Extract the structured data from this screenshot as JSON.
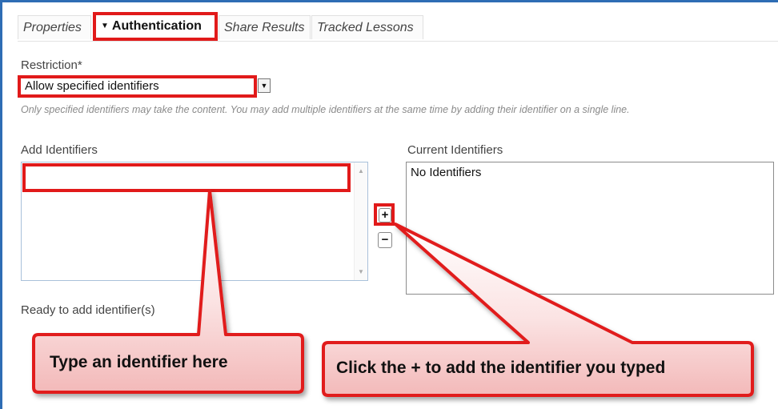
{
  "tabs": [
    {
      "label": "Properties",
      "active": false
    },
    {
      "label": "Authentication",
      "active": true
    },
    {
      "label": "Share Results",
      "active": false
    },
    {
      "label": "Tracked Lessons",
      "active": false
    }
  ],
  "restriction": {
    "label": "Restriction*",
    "selected": "Allow specified identifiers",
    "help": "Only specified identifiers may take the content. You may add multiple identifiers at the same time by adding their identifier on a single line."
  },
  "add_identifiers": {
    "label": "Add Identifiers",
    "value": "",
    "status": "Ready to add identifier(s)"
  },
  "current_identifiers": {
    "label": "Current Identifiers",
    "empty_text": "No Identifiers"
  },
  "buttons": {
    "add_symbol": "+",
    "remove_symbol": "−"
  },
  "callouts": {
    "input_hint": "Type an identifier here",
    "add_hint": "Click the + to add the identifier you typed"
  },
  "colors": {
    "highlight": "#e11a1a",
    "frame": "#2e6db4"
  }
}
